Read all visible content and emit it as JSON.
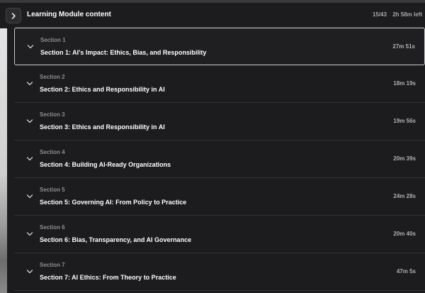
{
  "header": {
    "title": "Learning Module content",
    "progress": "15/43",
    "time_left": "2h 58m left"
  },
  "icons": {
    "toggle": "chevron-right-icon",
    "section_toggle": "chevron-down-icon"
  },
  "colors": {
    "background": "#1c1c1e",
    "active_border": "#c8c8c8",
    "muted_text": "#8e8e93"
  },
  "sections": [
    {
      "label": "Section 1",
      "title": "Section 1: AI's Impact: Ethics, Bias, and Responsibility",
      "duration": "27m 51s",
      "active": true
    },
    {
      "label": "Section 2",
      "title": "Section 2: Ethics and Responsibility in AI",
      "duration": "18m 19s",
      "active": false
    },
    {
      "label": "Section 3",
      "title": "Section 3: Ethics and Responsibility in AI",
      "duration": "19m 56s",
      "active": false
    },
    {
      "label": "Section 4",
      "title": "Section 4: Building AI-Ready Organizations",
      "duration": "20m 39s",
      "active": false
    },
    {
      "label": "Section 5",
      "title": "Section 5: Governing AI: From Policy to Practice",
      "duration": "24m 28s",
      "active": false
    },
    {
      "label": "Section 6",
      "title": "Section 6: Bias, Transparency, and AI Governance",
      "duration": "20m 40s",
      "active": false
    },
    {
      "label": "Section 7",
      "title": "Section 7: AI Ethics: From Theory to Practice",
      "duration": "47m 5s",
      "active": false
    }
  ]
}
